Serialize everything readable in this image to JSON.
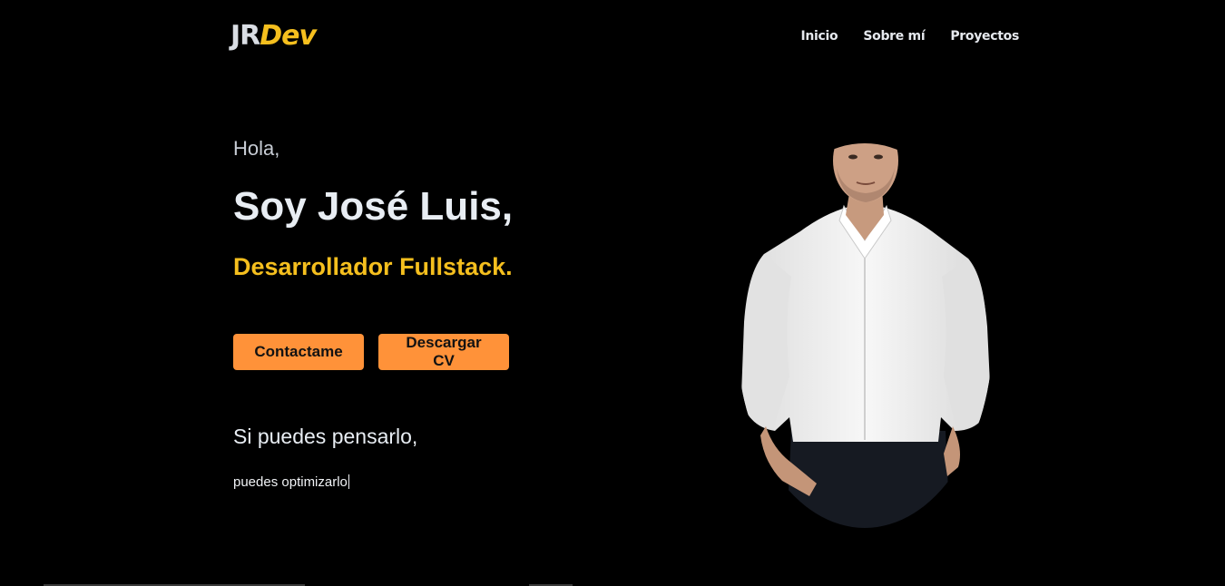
{
  "header": {
    "logo_primary": "JR",
    "logo_secondary": "Dev",
    "nav": [
      {
        "label": "Inicio"
      },
      {
        "label": "Sobre mí"
      },
      {
        "label": "Proyectos"
      }
    ]
  },
  "hero": {
    "greeting": "Hola,",
    "name": "Soy José Luis,",
    "role": "Desarrollador Fullstack.",
    "contact_button": "Contactame",
    "cv_button": "Descargar CV",
    "motto_line1": "Si puedes pensarlo,",
    "motto_line2": "puedes optimizarlo"
  },
  "colors": {
    "background": "#000000",
    "accent_yellow": "#f5bf1e",
    "button_orange": "#ff9239",
    "text_light": "#e8edf3"
  },
  "icons": {
    "portrait": "person-portrait-photo"
  }
}
